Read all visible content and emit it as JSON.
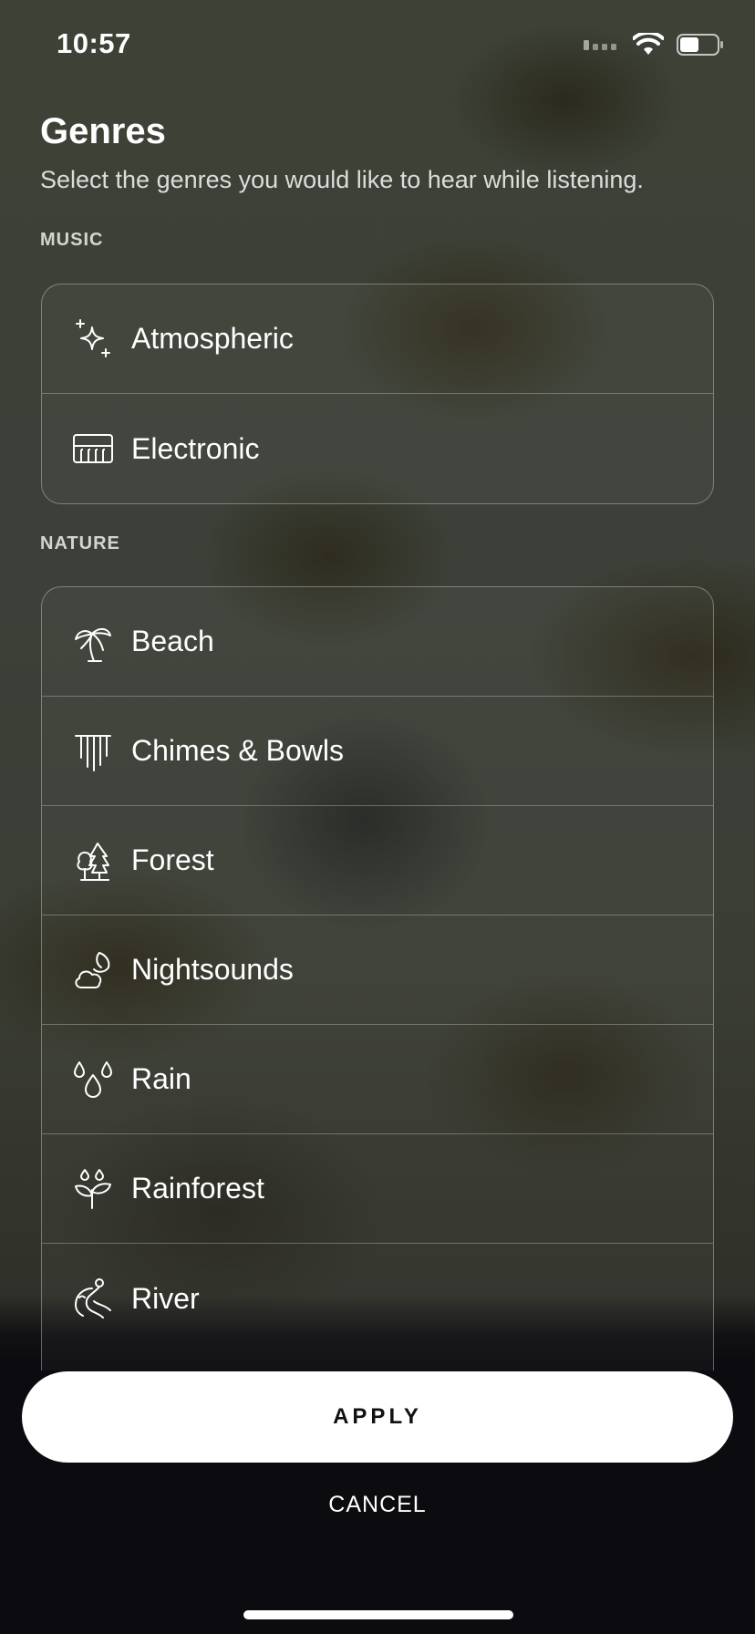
{
  "status_bar": {
    "time": "10:57"
  },
  "header": {
    "title": "Genres",
    "subtitle": "Select the genres you would like to hear while listening."
  },
  "sections": {
    "music": {
      "label": "MUSIC",
      "items": [
        {
          "label": "Atmospheric",
          "icon": "sparkle-icon"
        },
        {
          "label": "Electronic",
          "icon": "keyboard-icon"
        }
      ]
    },
    "nature": {
      "label": "NATURE",
      "items": [
        {
          "label": "Beach",
          "icon": "palm-tree-icon"
        },
        {
          "label": "Chimes & Bowls",
          "icon": "chimes-icon"
        },
        {
          "label": "Forest",
          "icon": "trees-icon"
        },
        {
          "label": "Nightsounds",
          "icon": "moon-cloud-icon"
        },
        {
          "label": "Rain",
          "icon": "raindrops-icon"
        },
        {
          "label": "Rainforest",
          "icon": "sprout-icon"
        },
        {
          "label": "River",
          "icon": "river-icon"
        }
      ]
    }
  },
  "actions": {
    "apply_label": "APPLY",
    "cancel_label": "CANCEL"
  },
  "colors": {
    "apply_bg": "#ffffff",
    "apply_text": "#111111",
    "bottom_bg": "#0c0c10"
  }
}
